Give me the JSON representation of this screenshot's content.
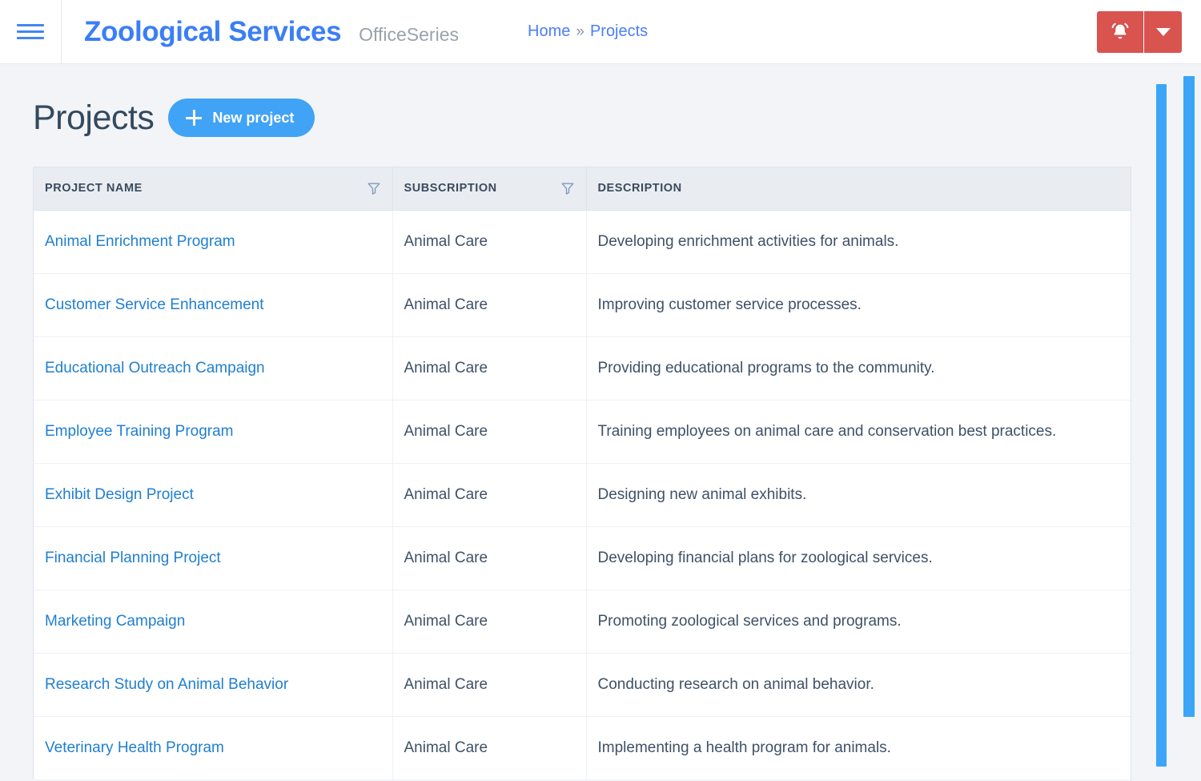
{
  "header": {
    "menu_icon": "hamburger-icon",
    "brand": "Zoological Services",
    "brand_suffix": "OfficeSeries",
    "breadcrumb": {
      "home": "Home",
      "separator": "»",
      "current": "Projects"
    },
    "alert_icon": "bell-alarm-icon",
    "dropdown_icon": "chevron-down-icon",
    "accent_color": "#3b7ef6",
    "alert_color": "#d9534f"
  },
  "page": {
    "title": "Projects",
    "new_project_label": "New project",
    "new_project_icon": "plus-icon",
    "button_color": "#40a3f5"
  },
  "table": {
    "columns": [
      {
        "label": "PROJECT NAME",
        "filter_icon": "filter-funnel-icon",
        "filterable": true
      },
      {
        "label": "SUBSCRIPTION",
        "filter_icon": "filter-funnel-icon",
        "filterable": true
      },
      {
        "label": "DESCRIPTION",
        "filter_icon": null,
        "filterable": false
      }
    ],
    "rows": [
      {
        "name": "Animal Enrichment Program",
        "subscription": "Animal Care",
        "description": "Developing enrichment activities for animals."
      },
      {
        "name": "Customer Service Enhancement",
        "subscription": "Animal Care",
        "description": "Improving customer service processes."
      },
      {
        "name": "Educational Outreach Campaign",
        "subscription": "Animal Care",
        "description": "Providing educational programs to the community."
      },
      {
        "name": "Employee Training Program",
        "subscription": "Animal Care",
        "description": "Training employees on animal care and conservation best practices."
      },
      {
        "name": "Exhibit Design Project",
        "subscription": "Animal Care",
        "description": "Designing new animal exhibits."
      },
      {
        "name": "Financial Planning Project",
        "subscription": "Animal Care",
        "description": "Developing financial plans for zoological services."
      },
      {
        "name": "Marketing Campaign",
        "subscription": "Animal Care",
        "description": "Promoting zoological services and programs."
      },
      {
        "name": "Research Study on Animal Behavior",
        "subscription": "Animal Care",
        "description": "Conducting research on animal behavior."
      },
      {
        "name": "Veterinary Health Program",
        "subscription": "Animal Care",
        "description": "Implementing a health program for animals."
      }
    ]
  },
  "scrollbars": {
    "inner_color": "#3da5f8",
    "outer_color": "#3da5f8"
  }
}
